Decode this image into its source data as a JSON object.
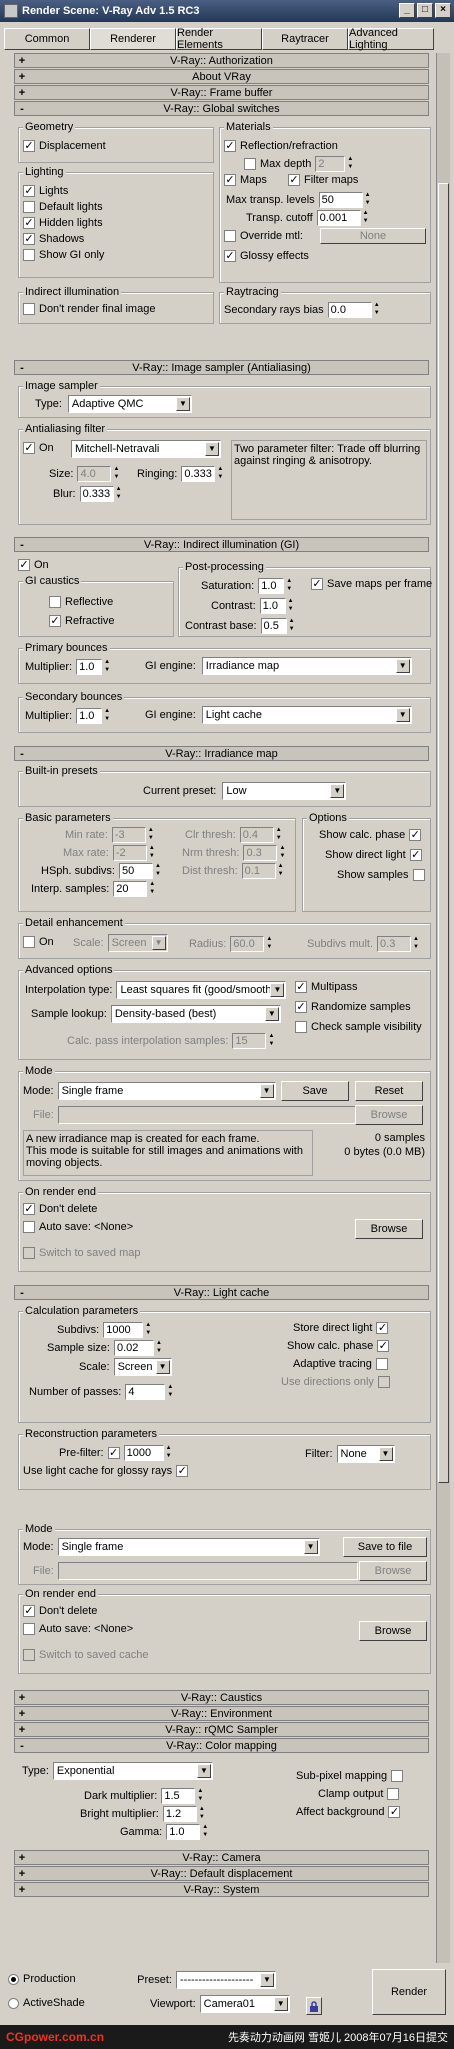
{
  "window": {
    "title": "Render Scene: V-Ray Adv 1.5 RC3",
    "min": "_",
    "max": "□",
    "close": "×"
  },
  "tabs": [
    "Common",
    "Renderer",
    "Render Elements",
    "Raytracer",
    "Advanced Lighting"
  ],
  "rollouts": {
    "auth": {
      "sign": "+",
      "title": "V-Ray:: Authorization"
    },
    "about": {
      "sign": "+",
      "title": "About VRay"
    },
    "fb": {
      "sign": "+",
      "title": "V-Ray:: Frame buffer"
    },
    "gs": {
      "sign": "-",
      "title": "V-Ray:: Global switches"
    },
    "is": {
      "sign": "-",
      "title": "V-Ray:: Image sampler (Antialiasing)"
    },
    "gi": {
      "sign": "-",
      "title": "V-Ray:: Indirect illumination (GI)"
    },
    "im": {
      "sign": "-",
      "title": "V-Ray:: Irradiance map"
    },
    "lc": {
      "sign": "-",
      "title": "V-Ray:: Light cache"
    },
    "caustics": {
      "sign": "+",
      "title": "V-Ray:: Caustics"
    },
    "env": {
      "sign": "+",
      "title": "V-Ray:: Environment"
    },
    "rqmc": {
      "sign": "+",
      "title": "V-Ray:: rQMC Sampler"
    },
    "cm": {
      "sign": "-",
      "title": "V-Ray:: Color mapping"
    },
    "camera": {
      "sign": "+",
      "title": "V-Ray:: Camera"
    },
    "disp": {
      "sign": "+",
      "title": "V-Ray:: Default displacement"
    },
    "system": {
      "sign": "+",
      "title": "V-Ray:: System"
    }
  },
  "gs": {
    "geometry": "Geometry",
    "displacement": "Displacement",
    "lighting": "Lighting",
    "lights": "Lights",
    "default_lights": "Default lights",
    "hidden_lights": "Hidden lights",
    "shadows": "Shadows",
    "show_gi_only": "Show GI only",
    "indirect": "Indirect illumination",
    "dont_render_final": "Don't render final image",
    "materials": "Materials",
    "refl_refr": "Reflection/refraction",
    "max_depth": "Max depth",
    "max_depth_val": "2",
    "maps": "Maps",
    "filter_maps": "Filter maps",
    "max_transp_levels": "Max transp. levels",
    "max_transp_val": "50",
    "transp_cutoff": "Transp. cutoff",
    "transp_cutoff_val": "0.001",
    "override_mtl": "Override mtl:",
    "none": "None",
    "glossy": "Glossy effects",
    "raytracing": "Raytracing",
    "secondary_bias": "Secondary rays bias",
    "secondary_bias_val": "0.0"
  },
  "is": {
    "image_sampler": "Image sampler",
    "type": "Type:",
    "type_val": "Adaptive QMC",
    "aa_filter": "Antialiasing filter",
    "on": "On",
    "filter_val": "Mitchell-Netravali",
    "desc": "Two parameter filter: Trade off blurring against ringing & anisotropy.",
    "size": "Size:",
    "size_val": "4.0",
    "ringing": "Ringing:",
    "ringing_val": "0.333",
    "blur": "Blur:",
    "blur_val": "0.333"
  },
  "gi": {
    "on": "On",
    "caustics": "GI caustics",
    "reflective": "Reflective",
    "refractive": "Refractive",
    "post": "Post-processing",
    "saturation": "Saturation:",
    "saturation_val": "1.0",
    "save_maps": "Save maps per frame",
    "contrast": "Contrast:",
    "contrast_val": "1.0",
    "contrast_base": "Contrast base:",
    "contrast_base_val": "0.5",
    "primary": "Primary bounces",
    "multiplier": "Multiplier:",
    "p_mult": "1.0",
    "engine": "GI engine:",
    "p_engine": "Irradiance map",
    "secondary": "Secondary bounces",
    "s_mult": "1.0",
    "s_engine": "Light cache"
  },
  "im": {
    "presets": "Built-in presets",
    "current_preset": "Current preset:",
    "preset_val": "Low",
    "basic": "Basic parameters",
    "min_rate": "Min rate:",
    "min_rate_val": "-3",
    "max_rate": "Max rate:",
    "max_rate_val": "-2",
    "hsph": "HSph. subdivs:",
    "hsph_val": "50",
    "interp": "Interp. samples:",
    "interp_val": "20",
    "clr": "Clr thresh:",
    "clr_val": "0.4",
    "nrm": "Nrm thresh:",
    "nrm_val": "0.3",
    "dist": "Dist thresh:",
    "dist_val": "0.1",
    "options": "Options",
    "show_calc": "Show calc. phase",
    "show_direct": "Show direct light",
    "show_samples": "Show samples",
    "detail": "Detail enhancement",
    "on": "On",
    "scale": "Scale:",
    "scale_val": "Screen",
    "radius": "Radius:",
    "radius_val": "60.0",
    "subdivs_mult": "Subdivs mult.",
    "subdivs_mult_val": "0.3",
    "advanced": "Advanced options",
    "interp_type": "Interpolation type:",
    "interp_type_val": "Least squares fit (good/smooth)",
    "multipass": "Multipass",
    "randomize": "Randomize samples",
    "check_vis": "Check sample visibility",
    "lookup": "Sample lookup:",
    "lookup_val": "Density-based (best)",
    "calc_pass": "Calc. pass interpolation samples:",
    "calc_pass_val": "15",
    "mode": "Mode",
    "mode_lbl": "Mode:",
    "mode_val": "Single frame",
    "save": "Save",
    "reset": "Reset",
    "file": "File:",
    "browse": "Browse",
    "info": "A new irradiance map is created for each frame.\nThis mode is suitable for still images and animations with moving objects.",
    "samples": "0 samples",
    "bytes": "0 bytes (0.0 MB)",
    "on_end": "On render end",
    "dont_delete": "Don't delete",
    "auto_save": "Auto save: <None>",
    "switch": "Switch to saved map"
  },
  "lc": {
    "calc": "Calculation parameters",
    "subdivs": "Subdivs:",
    "subdivs_val": "1000",
    "sample_size": "Sample size:",
    "sample_size_val": "0.02",
    "scale": "Scale:",
    "scale_val": "Screen",
    "passes": "Number of passes:",
    "passes_val": "4",
    "store_direct": "Store direct light",
    "show_calc": "Show calc. phase",
    "adaptive": "Adaptive tracing",
    "use_dirs": "Use directions only",
    "recon": "Reconstruction parameters",
    "prefilter": "Pre-filter:",
    "prefilter_val": "1000",
    "use_glossy": "Use light cache for glossy rays",
    "filter": "Filter:",
    "filter_val": "None",
    "mode": "Mode",
    "mode_lbl": "Mode:",
    "mode_val": "Single frame",
    "save_to_file": "Save to file",
    "file": "File:",
    "browse": "Browse",
    "on_end": "On render end",
    "dont_delete": "Don't delete",
    "auto_save": "Auto save: <None>",
    "switch": "Switch to saved cache"
  },
  "cm": {
    "type": "Type:",
    "type_val": "Exponential",
    "dark": "Dark multiplier:",
    "dark_val": "1.5",
    "bright": "Bright multiplier:",
    "bright_val": "1.2",
    "gamma": "Gamma:",
    "gamma_val": "1.0",
    "subpixel": "Sub-pixel mapping",
    "clamp": "Clamp output",
    "affect_bg": "Affect background"
  },
  "bottom": {
    "production": "Production",
    "activeshade": "ActiveShade",
    "preset": "Preset:",
    "preset_val": "--------------------",
    "viewport": "Viewport:",
    "viewport_val": "Camera01",
    "render": "Render"
  },
  "watermark": {
    "site": "CGpower.com.cn",
    "credit": "先奏动力动画网 雪姬儿 2008年07月16日提交"
  }
}
